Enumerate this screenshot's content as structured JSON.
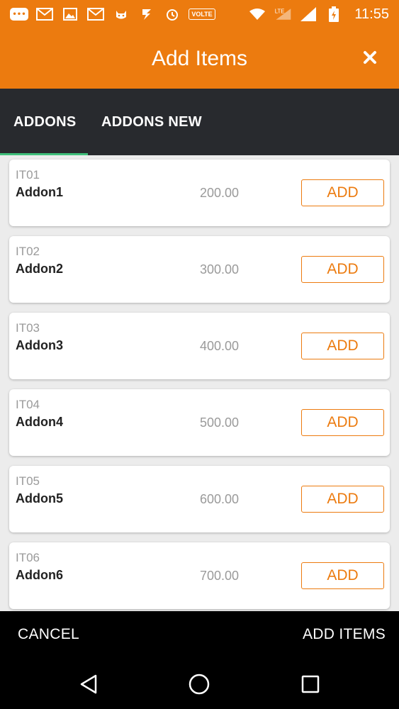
{
  "status_bar": {
    "time": "11:55",
    "volte": "VOLTE",
    "lte": "LTE",
    "icons": [
      "message-icon",
      "gmail-icon",
      "gallery-icon",
      "gmail-icon",
      "cat-icon",
      "flash-icon",
      "alarm-icon",
      "volte-icon",
      "wifi-icon",
      "lte-icon",
      "signal-icon",
      "signal-icon",
      "battery-icon"
    ]
  },
  "app_bar": {
    "title": "Add Items",
    "close_icon": "close-icon"
  },
  "tabs": [
    {
      "label": "ADDONS",
      "active": true
    },
    {
      "label": "ADDONS NEW",
      "active": false
    }
  ],
  "items": [
    {
      "code": "IT01",
      "name": "Addon1",
      "price": "200.00",
      "button": "ADD"
    },
    {
      "code": "IT02",
      "name": "Addon2",
      "price": "300.00",
      "button": "ADD"
    },
    {
      "code": "IT03",
      "name": "Addon3",
      "price": "400.00",
      "button": "ADD"
    },
    {
      "code": "IT04",
      "name": "Addon4",
      "price": "500.00",
      "button": "ADD"
    },
    {
      "code": "IT05",
      "name": "Addon5",
      "price": "600.00",
      "button": "ADD"
    },
    {
      "code": "IT06",
      "name": "Addon6",
      "price": "700.00",
      "button": "ADD"
    }
  ],
  "bottom_bar": {
    "cancel": "CANCEL",
    "add_items": "ADD ITEMS"
  },
  "colors": {
    "accent": "#ec7b0f",
    "tab_bar": "#282a2e",
    "tab_indicator": "#3fbf7a"
  }
}
